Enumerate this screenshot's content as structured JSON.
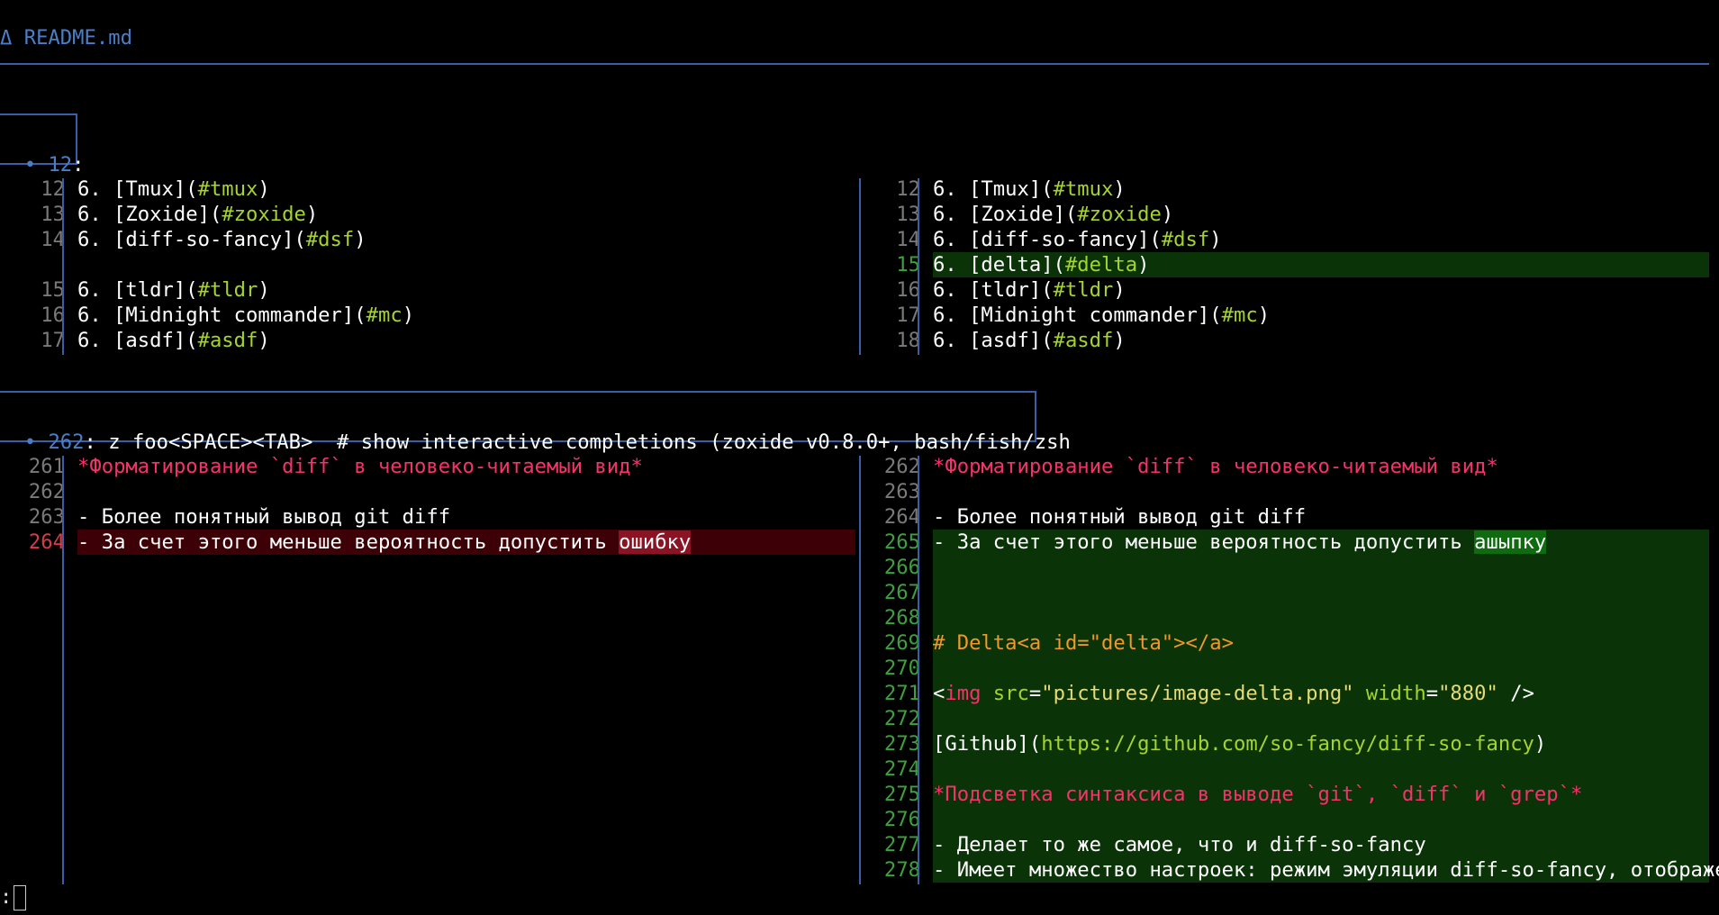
{
  "file_header": "Δ README.md",
  "hunk1": {
    "dot": "•",
    "line": "12",
    "suffix": ":",
    "context": ""
  },
  "hunk2": {
    "dot": "•",
    "line": "262",
    "suffix": ":",
    "context": " z foo<SPACE><TAB>  # show interactive completions (zoxide v0.8.0+, bash/fish/zsh"
  },
  "hunk1_left": [
    {
      "ln": "12",
      "parts": [
        [
          "6. ",
          "c-white"
        ],
        [
          "[Tmux](",
          "c-white"
        ],
        [
          "#tmux",
          "c-green"
        ],
        [
          ")",
          "c-white"
        ]
      ]
    },
    {
      "ln": "13",
      "parts": [
        [
          "6. ",
          "c-white"
        ],
        [
          "[Zoxide](",
          "c-white"
        ],
        [
          "#zoxide",
          "c-green"
        ],
        [
          ")",
          "c-white"
        ]
      ]
    },
    {
      "ln": "14",
      "parts": [
        [
          "6. ",
          "c-white"
        ],
        [
          "[diff-so-fancy](",
          "c-white"
        ],
        [
          "#dsf",
          "c-green"
        ],
        [
          ")",
          "c-white"
        ]
      ]
    },
    {
      "ln": "",
      "parts": []
    },
    {
      "ln": "15",
      "parts": [
        [
          "6. ",
          "c-white"
        ],
        [
          "[tldr](",
          "c-white"
        ],
        [
          "#tldr",
          "c-green"
        ],
        [
          ")",
          "c-white"
        ]
      ]
    },
    {
      "ln": "16",
      "parts": [
        [
          "6. ",
          "c-white"
        ],
        [
          "[Midnight commander](",
          "c-white"
        ],
        [
          "#mc",
          "c-green"
        ],
        [
          ")",
          "c-white"
        ]
      ]
    },
    {
      "ln": "17",
      "parts": [
        [
          "6. ",
          "c-white"
        ],
        [
          "[asdf](",
          "c-white"
        ],
        [
          "#asdf",
          "c-green"
        ],
        [
          ")",
          "c-white"
        ]
      ]
    }
  ],
  "hunk1_right": [
    {
      "ln": "12",
      "parts": [
        [
          "6. ",
          "c-white"
        ],
        [
          "[Tmux](",
          "c-white"
        ],
        [
          "#tmux",
          "c-green"
        ],
        [
          ")",
          "c-white"
        ]
      ]
    },
    {
      "ln": "13",
      "parts": [
        [
          "6. ",
          "c-white"
        ],
        [
          "[Zoxide](",
          "c-white"
        ],
        [
          "#zoxide",
          "c-green"
        ],
        [
          ")",
          "c-white"
        ]
      ]
    },
    {
      "ln": "14",
      "parts": [
        [
          "6. ",
          "c-white"
        ],
        [
          "[diff-so-fancy](",
          "c-white"
        ],
        [
          "#dsf",
          "c-green"
        ],
        [
          ")",
          "c-white"
        ]
      ]
    },
    {
      "ln": "15",
      "kind": "plus",
      "parts": [
        [
          "6. ",
          "c-white"
        ],
        [
          "[delta](",
          "c-white"
        ],
        [
          "#delta",
          "c-green"
        ],
        [
          ")",
          "c-white"
        ]
      ]
    },
    {
      "ln": "16",
      "parts": [
        [
          "6. ",
          "c-white"
        ],
        [
          "[tldr](",
          "c-white"
        ],
        [
          "#tldr",
          "c-green"
        ],
        [
          ")",
          "c-white"
        ]
      ]
    },
    {
      "ln": "17",
      "parts": [
        [
          "6. ",
          "c-white"
        ],
        [
          "[Midnight commander](",
          "c-white"
        ],
        [
          "#mc",
          "c-green"
        ],
        [
          ")",
          "c-white"
        ]
      ]
    },
    {
      "ln": "18",
      "parts": [
        [
          "6. ",
          "c-white"
        ],
        [
          "[asdf](",
          "c-white"
        ],
        [
          "#asdf",
          "c-green"
        ],
        [
          ")",
          "c-white"
        ]
      ]
    }
  ],
  "hunk2_left": [
    {
      "ln": "261",
      "parts": [
        [
          "*Форматирование `diff` в человеко-читаемый вид*",
          "c-red"
        ]
      ]
    },
    {
      "ln": "262",
      "parts": []
    },
    {
      "ln": "263",
      "parts": [
        [
          "- ",
          "c-white"
        ],
        [
          "Более понятный вывод git diff",
          "c-white"
        ]
      ]
    },
    {
      "ln": "264",
      "kind": "minus",
      "parts": [
        [
          "- ",
          "c-white"
        ],
        [
          "За счет этого меньше вероятность допустить ",
          "c-white"
        ],
        [
          "ошибку",
          "c-white",
          "emph-minus"
        ]
      ]
    }
  ],
  "hunk2_right": [
    {
      "ln": "262",
      "parts": [
        [
          "*Форматирование `diff` в человеко-читаемый вид*",
          "c-red"
        ]
      ]
    },
    {
      "ln": "263",
      "parts": []
    },
    {
      "ln": "264",
      "parts": [
        [
          "- ",
          "c-white"
        ],
        [
          "Более понятный вывод git diff",
          "c-white"
        ]
      ]
    },
    {
      "ln": "265",
      "kind": "plus",
      "parts": [
        [
          "- ",
          "c-white"
        ],
        [
          "За счет этого меньше вероятность допустить ",
          "c-white"
        ],
        [
          "ашыпку",
          "c-white",
          "emph-plus"
        ]
      ]
    },
    {
      "ln": "266",
      "kind": "plus",
      "parts": []
    },
    {
      "ln": "267",
      "kind": "plus",
      "parts": []
    },
    {
      "ln": "268",
      "kind": "plus",
      "parts": []
    },
    {
      "ln": "269",
      "kind": "plus",
      "parts": [
        [
          "# Delta<a id=\"delta\"></a>",
          "c-orange"
        ]
      ]
    },
    {
      "ln": "270",
      "kind": "plus",
      "parts": []
    },
    {
      "ln": "271",
      "kind": "plus",
      "parts": [
        [
          "<",
          "c-white"
        ],
        [
          "img",
          "c-red"
        ],
        [
          " ",
          "c-white"
        ],
        [
          "src",
          "c-green"
        ],
        [
          "=",
          "c-white"
        ],
        [
          "\"pictures/image-delta.png\"",
          "c-yellow"
        ],
        [
          " ",
          "c-white"
        ],
        [
          "width",
          "c-green"
        ],
        [
          "=",
          "c-white"
        ],
        [
          "\"880\"",
          "c-yellow"
        ],
        [
          " />",
          "c-white"
        ]
      ]
    },
    {
      "ln": "272",
      "kind": "plus",
      "parts": []
    },
    {
      "ln": "273",
      "kind": "plus",
      "parts": [
        [
          "[Github](",
          "c-white"
        ],
        [
          "https://github.com/so-fancy/diff-so-fancy",
          "c-green"
        ],
        [
          ")",
          "c-white"
        ]
      ]
    },
    {
      "ln": "274",
      "kind": "plus",
      "parts": []
    },
    {
      "ln": "275",
      "kind": "plus",
      "parts": [
        [
          "*Подсветка синтаксиса в выводе `git`, `diff` и `grep`*",
          "c-red"
        ]
      ]
    },
    {
      "ln": "276",
      "kind": "plus",
      "parts": []
    },
    {
      "ln": "277",
      "kind": "plus",
      "parts": [
        [
          "- ",
          "c-white"
        ],
        [
          "Делает то же самое, что и diff-so-fancy",
          "c-white"
        ]
      ]
    },
    {
      "ln": "278",
      "kind": "plus",
      "parts": [
        [
          "- ",
          "c-white"
        ],
        [
          "Имеет множество настроек: режим эмуляции diff-so-fancy, отображе",
          "c-white"
        ],
        [
          "↵",
          "c-grey"
        ]
      ]
    }
  ],
  "command_prompt": ":",
  "colors": {
    "rule": "#3a5ea8",
    "minus_bg": "#3d0007",
    "plus_bg": "#0b3308",
    "minus_emph": "#8a1423",
    "plus_emph": "#0f6a10"
  }
}
